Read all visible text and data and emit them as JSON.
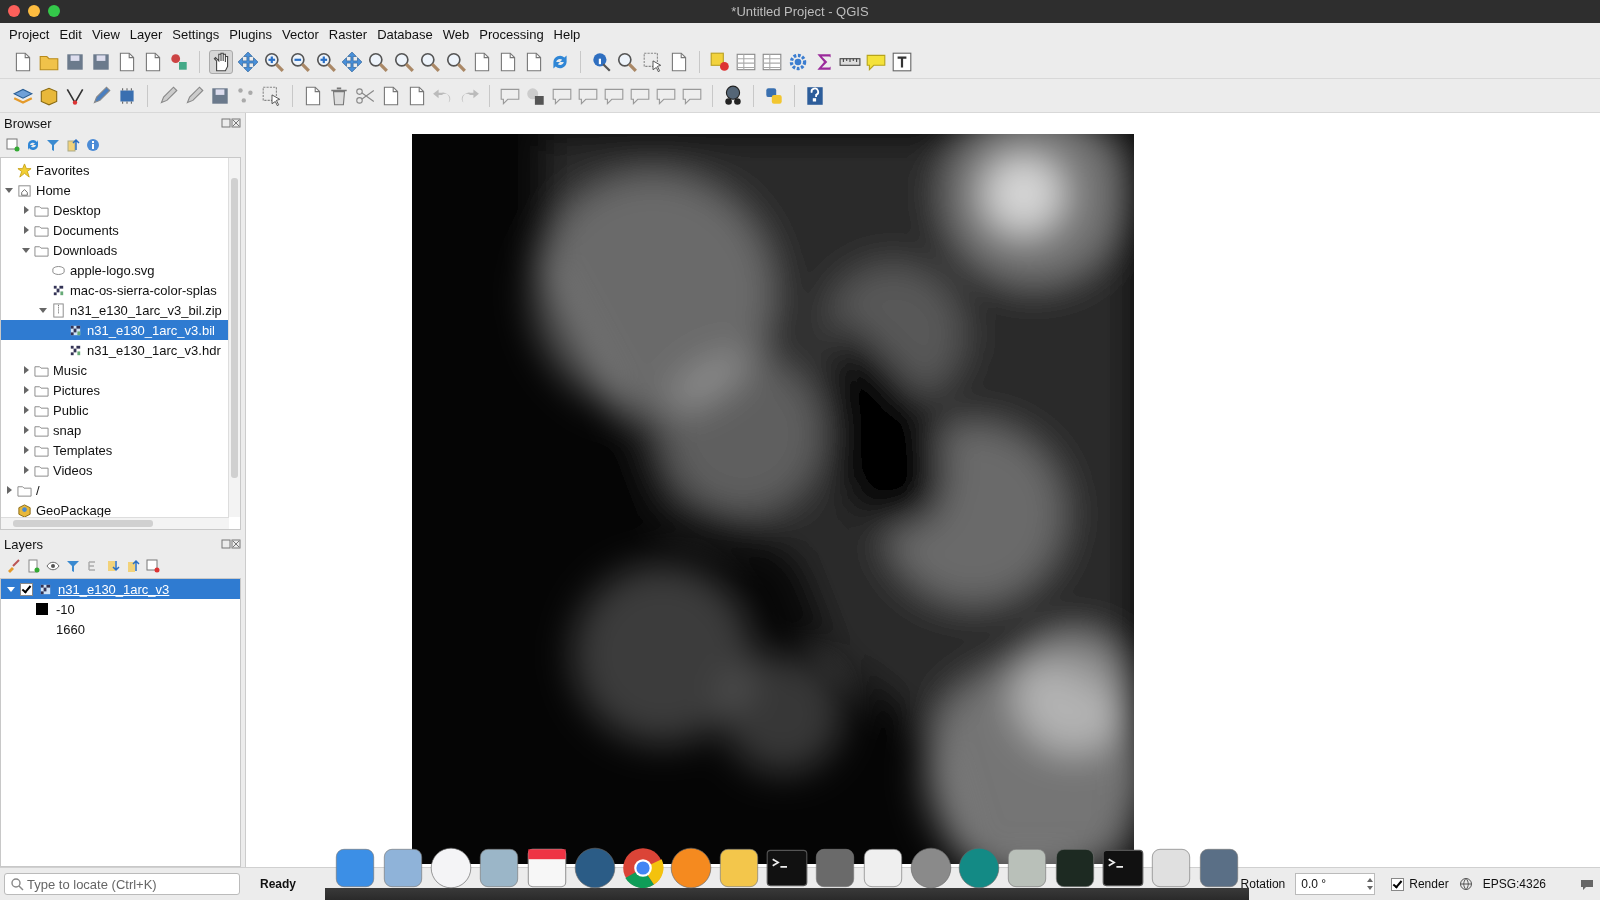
{
  "window": {
    "title": "*Untitled Project - QGIS"
  },
  "menu": [
    "Project",
    "Edit",
    "View",
    "Layer",
    "Settings",
    "Plugins",
    "Vector",
    "Raster",
    "Database",
    "Web",
    "Processing",
    "Help"
  ],
  "browser": {
    "title": "Browser",
    "items": [
      {
        "label": "Favorites",
        "kind": "favorites",
        "selected": false
      },
      {
        "label": "Home",
        "kind": "home",
        "expanded": true,
        "selected": false,
        "children": [
          {
            "label": "Desktop",
            "kind": "folder",
            "expanded": false,
            "selected": false
          },
          {
            "label": "Documents",
            "kind": "folder",
            "expanded": false,
            "selected": false
          },
          {
            "label": "Downloads",
            "kind": "folder",
            "expanded": true,
            "selected": false,
            "children": [
              {
                "label": "apple-logo.svg",
                "kind": "vector",
                "selected": false
              },
              {
                "label": "mac-os-sierra-color-splas",
                "kind": "raster",
                "selected": false
              },
              {
                "label": "n31_e130_1arc_v3_bil.zip",
                "kind": "zip",
                "expanded": true,
                "selected": false,
                "children": [
                  {
                    "label": "n31_e130_1arc_v3.bil",
                    "kind": "raster",
                    "selected": true
                  },
                  {
                    "label": "n31_e130_1arc_v3.hdr",
                    "kind": "raster",
                    "selected": false
                  }
                ]
              }
            ]
          },
          {
            "label": "Music",
            "kind": "folder",
            "expanded": false,
            "selected": false
          },
          {
            "label": "Pictures",
            "kind": "folder",
            "expanded": false,
            "selected": false
          },
          {
            "label": "Public",
            "kind": "folder",
            "expanded": false,
            "selected": false
          },
          {
            "label": "snap",
            "kind": "folder",
            "expanded": false,
            "selected": false
          },
          {
            "label": "Templates",
            "kind": "folder",
            "expanded": false,
            "selected": false
          },
          {
            "label": "Videos",
            "kind": "folder",
            "expanded": false,
            "selected": false
          }
        ]
      },
      {
        "label": "/",
        "kind": "folder",
        "expanded": false,
        "selected": false
      },
      {
        "label": "GeoPackage",
        "kind": "geopackage",
        "selected": false
      }
    ]
  },
  "layers": {
    "title": "Layers",
    "items": [
      {
        "label": "n31_e130_1arc_v3",
        "checked": true,
        "selected": true,
        "expanded": true,
        "legend": [
          {
            "label": "-10",
            "color": "#000000"
          },
          {
            "label": "1660"
          }
        ]
      }
    ]
  },
  "status_bar": {
    "locate_placeholder": "Type to locate (Ctrl+K)",
    "message": "Ready",
    "rotation_label": "Rotation",
    "rotation_value": "0.0 °",
    "render": {
      "label": "Render",
      "checked": true
    },
    "crs": "EPSG:4326"
  }
}
